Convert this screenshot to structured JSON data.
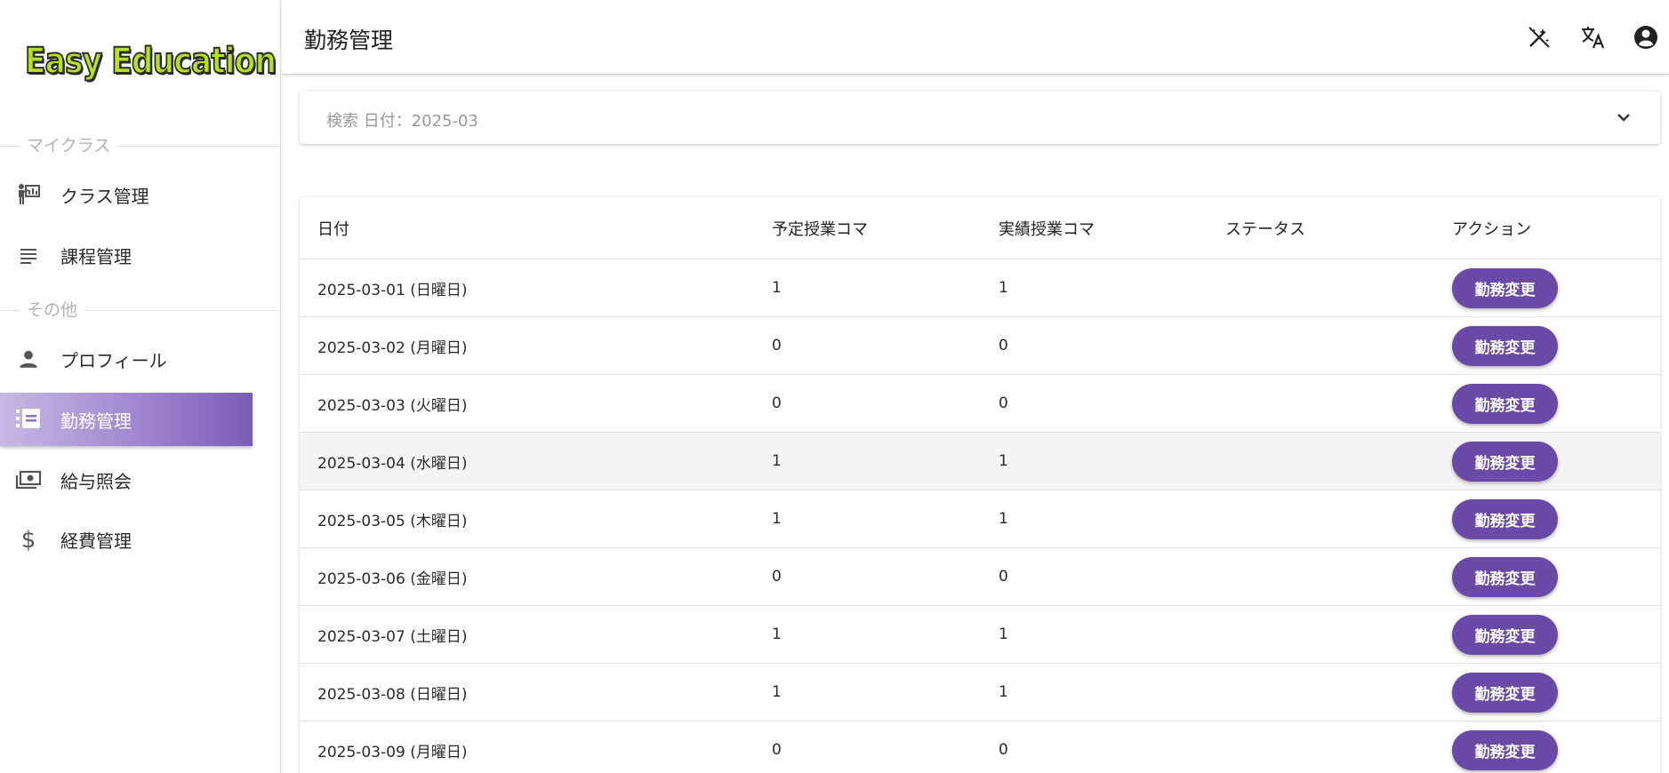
{
  "app": {
    "logo_text": "Easy Education"
  },
  "header": {
    "title": "勤務管理",
    "icons": [
      "theme-toggle-icon",
      "translate-icon",
      "account-icon"
    ]
  },
  "sidebar": {
    "sections": [
      {
        "label": "マイクラス"
      },
      {
        "label": "その他"
      }
    ],
    "items": [
      {
        "label": "クラス管理",
        "icon": "class-icon"
      },
      {
        "label": "課程管理",
        "icon": "list-icon"
      },
      {
        "label": "プロフィール",
        "icon": "person-icon"
      },
      {
        "label": "勤務管理",
        "icon": "attendance-icon",
        "active": true
      },
      {
        "label": "給与照会",
        "icon": "money-icon"
      },
      {
        "label": "経費管理",
        "icon": "dollar-icon"
      }
    ]
  },
  "search": {
    "label": "検索 日付：2025-03"
  },
  "table": {
    "columns": [
      "日付",
      "予定授業コマ",
      "実績授業コマ",
      "ステータス",
      "アクション"
    ],
    "action_label": "勤務変更",
    "rows": [
      {
        "date": "2025-03-01 (日曜日)",
        "planned": "1",
        "actual": "1",
        "status": ""
      },
      {
        "date": "2025-03-02 (月曜日)",
        "planned": "0",
        "actual": "0",
        "status": ""
      },
      {
        "date": "2025-03-03 (火曜日)",
        "planned": "0",
        "actual": "0",
        "status": ""
      },
      {
        "date": "2025-03-04 (水曜日)",
        "planned": "1",
        "actual": "1",
        "status": ""
      },
      {
        "date": "2025-03-05 (木曜日)",
        "planned": "1",
        "actual": "1",
        "status": ""
      },
      {
        "date": "2025-03-06 (金曜日)",
        "planned": "0",
        "actual": "0",
        "status": ""
      },
      {
        "date": "2025-03-07 (土曜日)",
        "planned": "1",
        "actual": "1",
        "status": ""
      },
      {
        "date": "2025-03-08 (日曜日)",
        "planned": "1",
        "actual": "1",
        "status": ""
      },
      {
        "date": "2025-03-09 (月曜日)",
        "planned": "0",
        "actual": "0",
        "status": ""
      }
    ]
  },
  "colors": {
    "accent": "#6a4aa6",
    "logo": "#b6e21c",
    "active_nav_end": "#7a5cb6"
  }
}
